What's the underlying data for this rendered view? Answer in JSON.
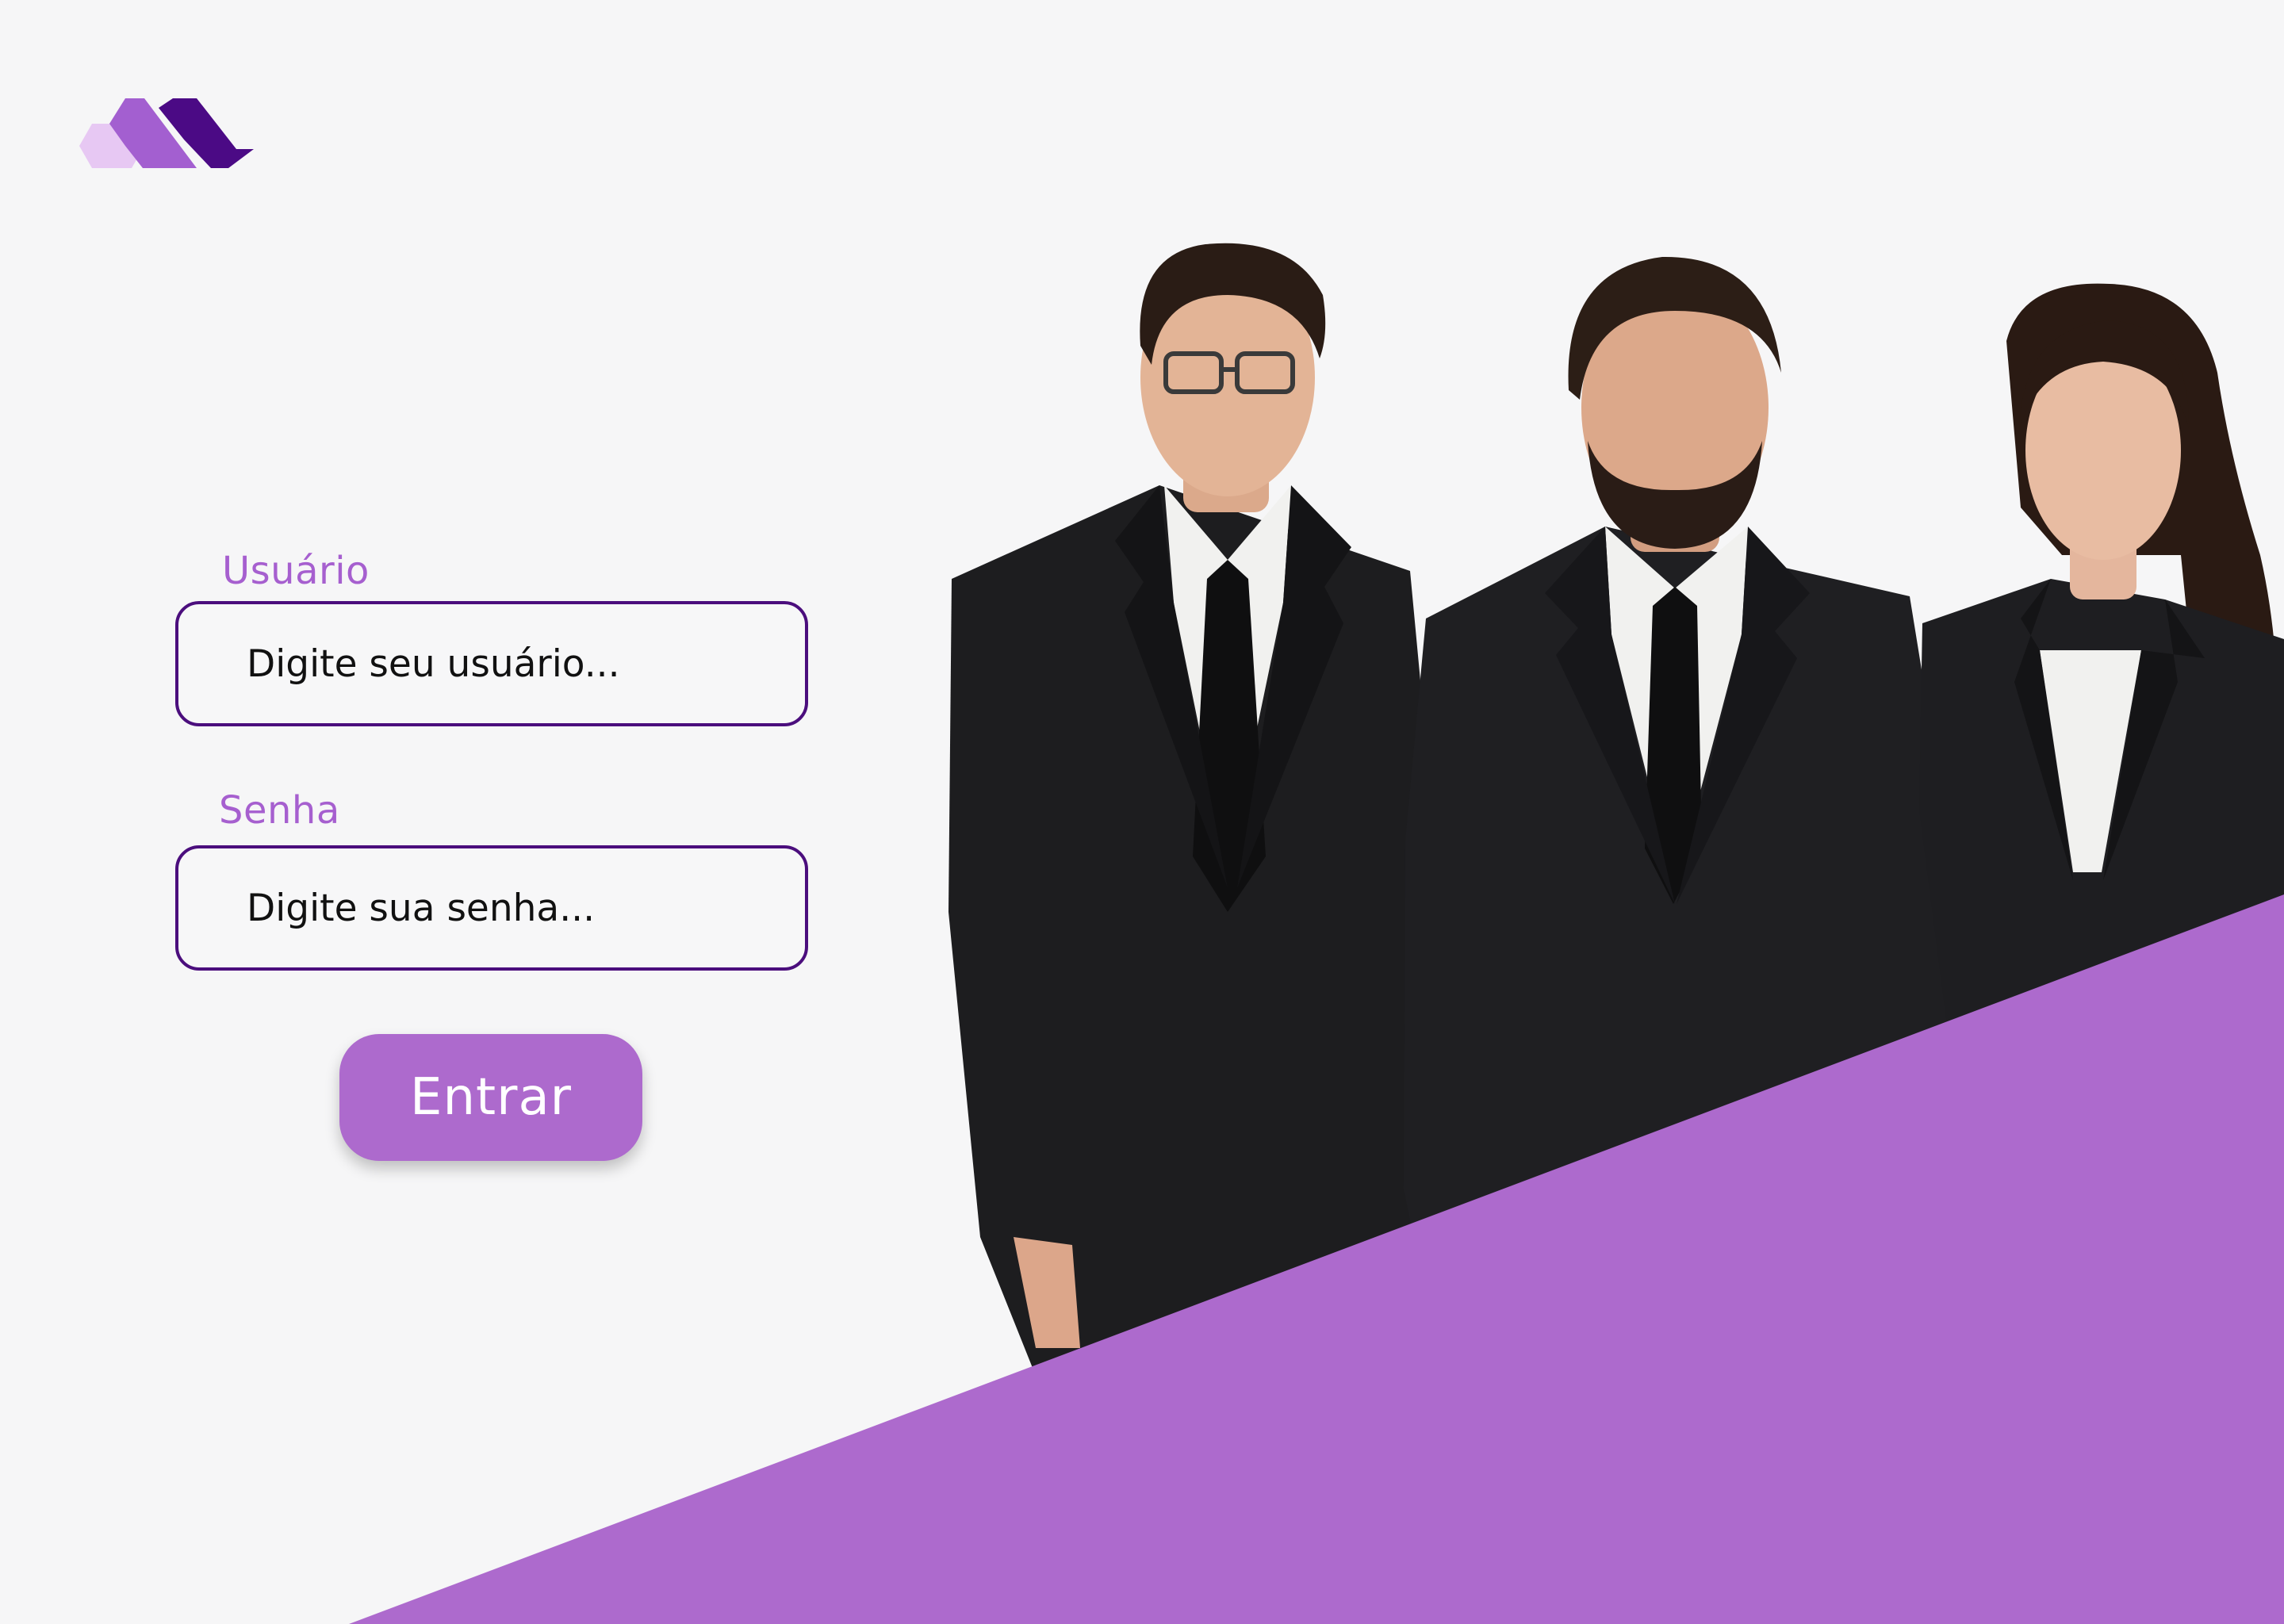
{
  "brand": {
    "logo_icon": "m-hexagon-logo",
    "colors": {
      "light": "#e7c8f3",
      "mid": "#a35fd0",
      "dark": "#4b0a85"
    }
  },
  "form": {
    "username": {
      "label": "Usuário",
      "placeholder": "Digite seu usuário..."
    },
    "password": {
      "label": "Senha",
      "placeholder": "Digite sua senha..."
    },
    "submit_label": "Entrar"
  },
  "hero": {
    "image": "three people in black business suits",
    "accent_color": "#ad6acd"
  },
  "colors": {
    "background": "#f6f6f7",
    "accent": "#ad6acd",
    "label": "#a65fcf",
    "input_border": "#4b0e7d",
    "input_text": "#111111",
    "button_text": "#ffffff"
  }
}
